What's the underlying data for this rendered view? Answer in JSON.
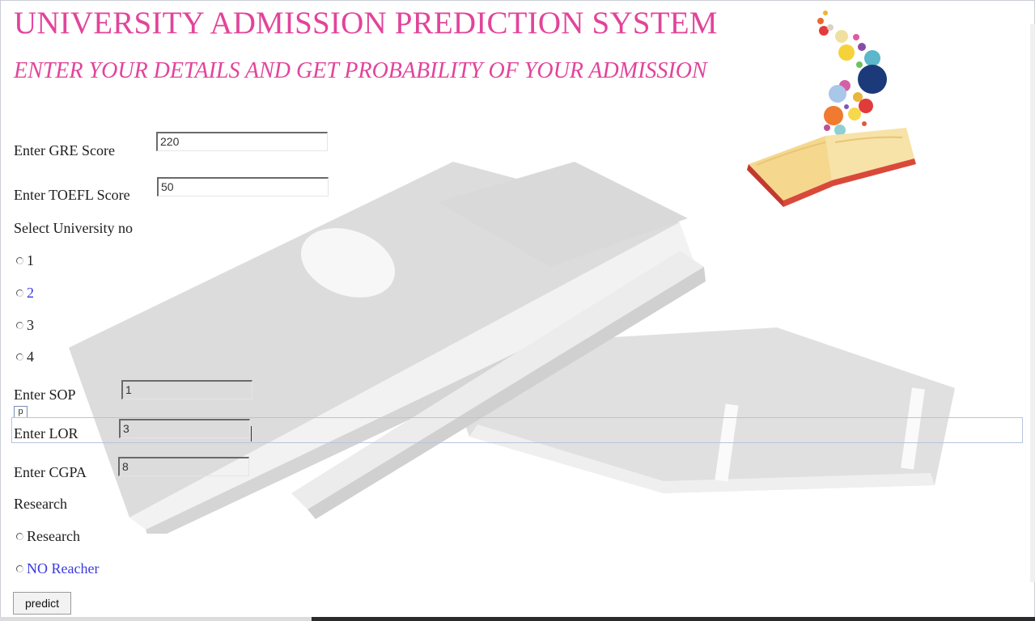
{
  "header": {
    "title": "UNIVERSITY ADMISSION PREDICTION SYSTEM",
    "subtitle": "ENTER YOUR DETAILS AND GET PROBABILITY OF YOUR ADMISSION"
  },
  "form": {
    "gre": {
      "label": "Enter GRE Score",
      "value": "220"
    },
    "toefl": {
      "label": "Enter TOEFL Score",
      "value": "50"
    },
    "university": {
      "label": "Select University no",
      "options": [
        "1",
        "2",
        "3",
        "4"
      ]
    },
    "sop": {
      "label": "Enter SOP",
      "value": "1"
    },
    "lor": {
      "label": "Enter LOR",
      "value": "3"
    },
    "cgpa": {
      "label": "Enter CGPA",
      "value": "8"
    },
    "research": {
      "label": "Research",
      "options": [
        "Research",
        "NO Reacher"
      ]
    },
    "p_chip": "p",
    "predict_label": "predict"
  },
  "colors": {
    "title": "#e2449a",
    "link_blue": "#3a3ae0"
  },
  "icons": {
    "logo": "open-book-bubbles-icon",
    "background": "books-illustration"
  }
}
